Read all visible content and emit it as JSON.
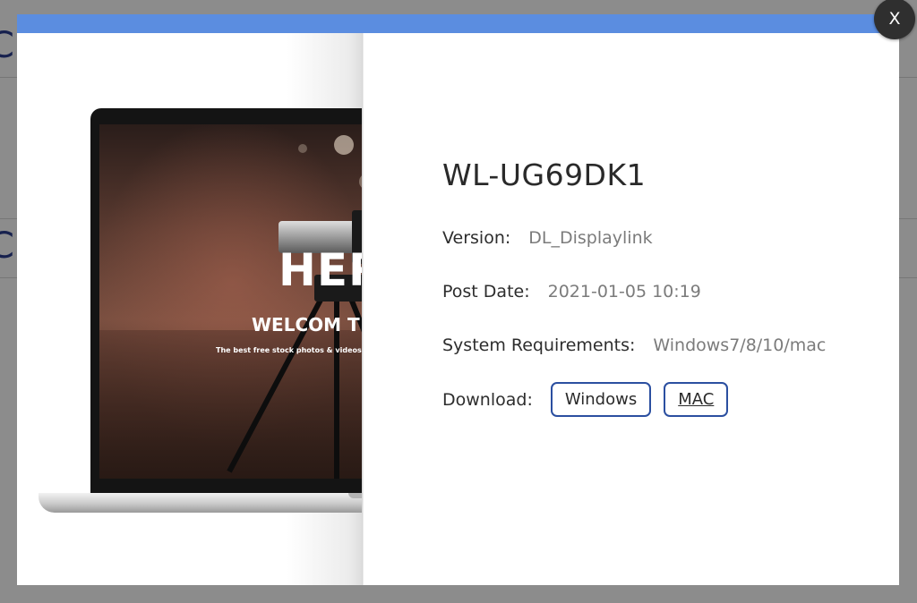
{
  "background": {
    "glyphs": [
      "C",
      "C"
    ]
  },
  "modal": {
    "close_label": "X",
    "accent_color": "#5b8de0",
    "preview": {
      "hero": "HER",
      "welcome": "WELCOM T",
      "tagline": "The best free stock photos & videos shared by talented creato"
    },
    "product": {
      "title": "WL-UG69DK1",
      "version_label": "Version:",
      "version_value": "DL_Displaylink",
      "post_date_label": "Post Date:",
      "post_date_value": "2021-01-05 10:19",
      "requirements_label": "System Requirements:",
      "requirements_value": "Windows7/8/10/mac",
      "download_label": "Download:",
      "download_buttons": [
        {
          "label": "Windows"
        },
        {
          "label": "MAC"
        }
      ]
    }
  },
  "icons": {
    "close": "close-icon",
    "social": [
      "facebook-icon",
      "pinterest-icon",
      "linkedin-icon",
      "twitter-icon",
      "yahoo-icon"
    ]
  }
}
